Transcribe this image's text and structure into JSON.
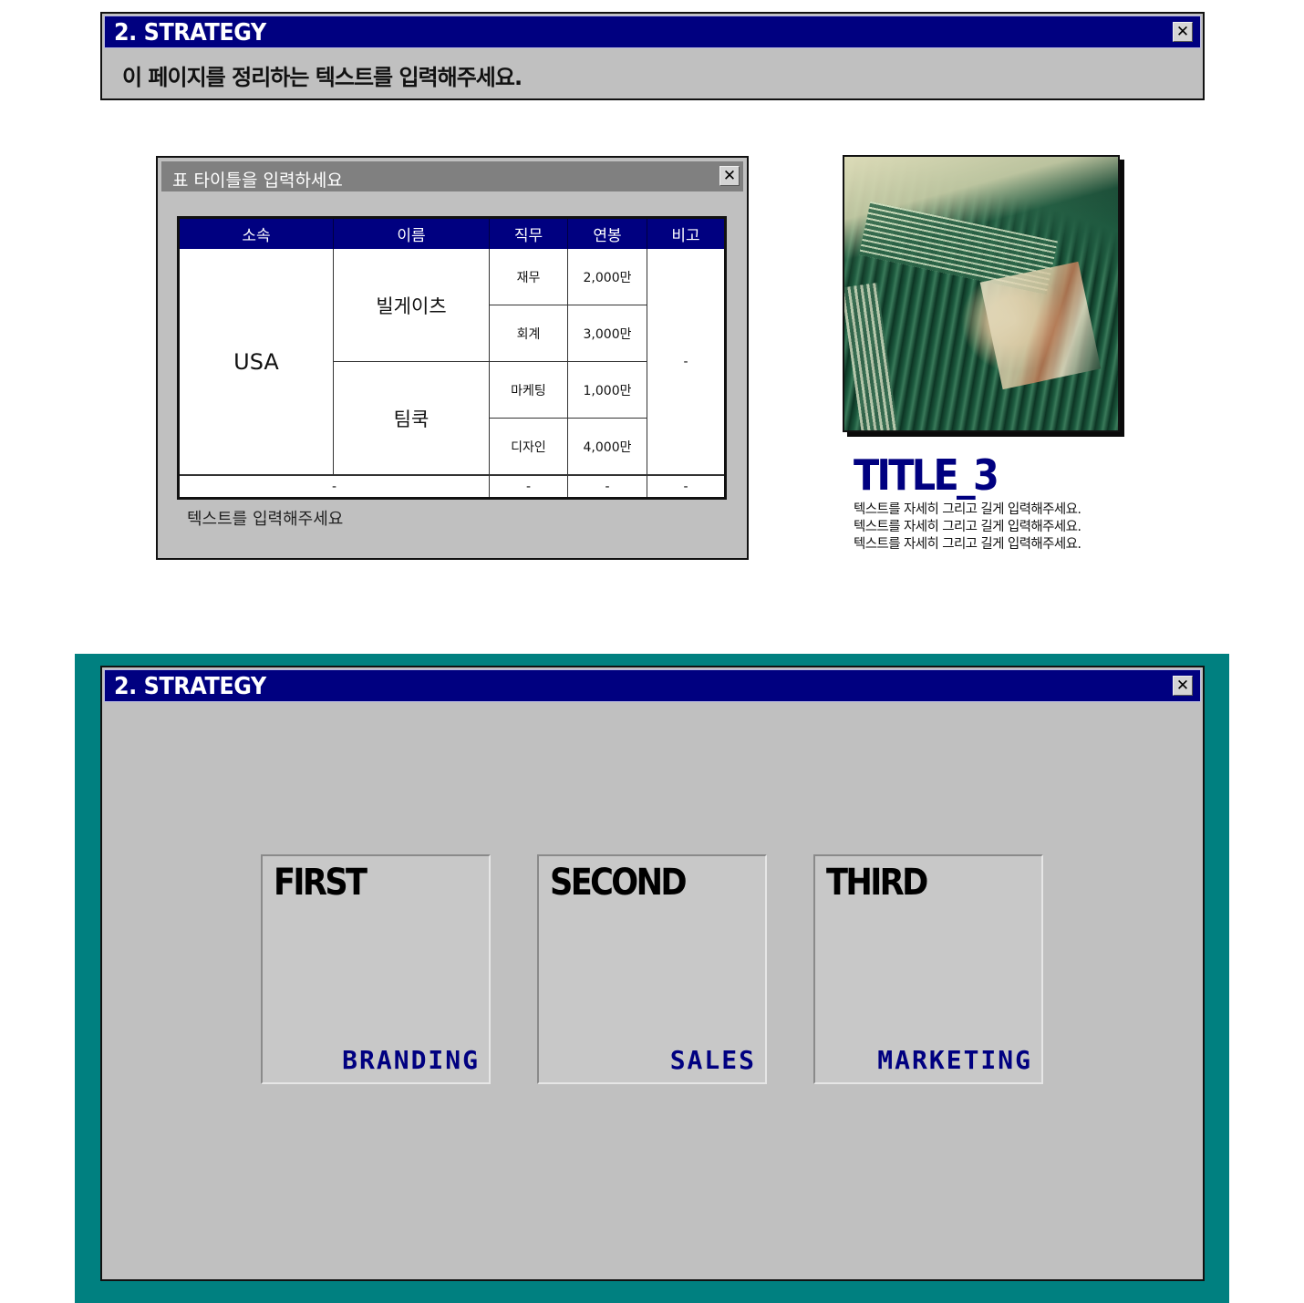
{
  "top_window": {
    "title": "2. STRATEGY",
    "close_glyph": "✕",
    "subtitle": "이 페이지를 정리하는 텍스트를 입력해주세요."
  },
  "table_window": {
    "title": "표 타이틀을 입력하세요",
    "close_glyph": "✕",
    "headers": [
      "소속",
      "이름",
      "직무",
      "연봉",
      "비고"
    ],
    "affiliation": "USA",
    "people": [
      {
        "name": "빌게이츠",
        "roles": [
          {
            "role": "재무",
            "salary": "2,000만"
          },
          {
            "role": "회계",
            "salary": "3,000만"
          }
        ]
      },
      {
        "name": "팀쿡",
        "roles": [
          {
            "role": "마케팅",
            "salary": "1,000만"
          },
          {
            "role": "디자인",
            "salary": "4,000만"
          }
        ]
      }
    ],
    "remark": "-",
    "footer_row": [
      "-",
      "-",
      "-",
      "-"
    ],
    "note": "텍스트를 입력해주세요"
  },
  "feature": {
    "image_alt": "green-tinted stack of vinyl record sleeves",
    "title": "TITLE_3",
    "lines": [
      "텍스트를 자세히 그리고 길게 입력해주세요.",
      "텍스트를 자세히 그리고 길게 입력해주세요.",
      "텍스트를 자세히 그리고 길게 입력해주세요."
    ]
  },
  "bottom_window": {
    "title": "2. STRATEGY",
    "close_glyph": "✕",
    "cards": [
      {
        "heading": "FIRST",
        "label": "BRANDING"
      },
      {
        "heading": "SECOND",
        "label": "SALES"
      },
      {
        "heading": "THIRD",
        "label": "MARKETING"
      }
    ]
  },
  "colors": {
    "titlebar": "#000080",
    "window": "#c0c0c0",
    "desktop": "#008080",
    "inactive_titlebar": "#808080",
    "accent_text": "#000080"
  }
}
